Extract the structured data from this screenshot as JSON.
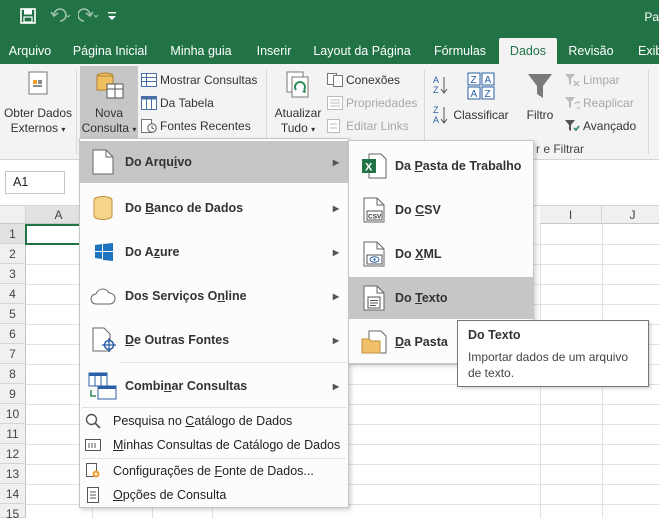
{
  "window": {
    "title": "Pa"
  },
  "tabs": [
    {
      "label": "Arquivo"
    },
    {
      "label": "Página Inicial"
    },
    {
      "label": "Minha guia"
    },
    {
      "label": "Inserir"
    },
    {
      "label": "Layout da Página"
    },
    {
      "label": "Fórmulas"
    },
    {
      "label": "Dados"
    },
    {
      "label": "Revisão"
    },
    {
      "label": "Exib"
    }
  ],
  "ribbon": {
    "external_data": {
      "line1": "Obter Dados",
      "line2": "Externos"
    },
    "new_query": {
      "line1": "Nova",
      "line2": "Consulta"
    },
    "show_queries": "Mostrar Consultas",
    "from_table": "Da Tabela",
    "recent_sources": "Fontes Recentes",
    "refresh_all": {
      "line1": "Atualizar",
      "line2": "Tudo"
    },
    "connections": "Conexões",
    "properties": "Propriedades",
    "edit_links": "Editar Links",
    "sort": "Classificar",
    "filter": "Filtro",
    "clear": "Limpar",
    "reapply": "Reaplicar",
    "advanced": "Avançado",
    "group_sort_filter": "r e Filtrar"
  },
  "namebox": "A1",
  "grid": {
    "columns": [
      "A",
      "I",
      "J"
    ],
    "rows": [
      "1",
      "2",
      "3",
      "4",
      "5",
      "6",
      "7",
      "8",
      "9",
      "10",
      "11",
      "12",
      "13",
      "14",
      "15"
    ]
  },
  "menu_main": {
    "items": [
      {
        "pre": "Do Arqu",
        "u": "i",
        "post": "vo"
      },
      {
        "pre": "Do ",
        "u": "B",
        "post": "anco de Dados"
      },
      {
        "pre": "Do A",
        "u": "z",
        "post": "ure"
      },
      {
        "pre": "Dos Serviços O",
        "u": "n",
        "post": "line"
      },
      {
        "pre": "",
        "u": "D",
        "post": "e Outras Fontes"
      },
      {
        "pre": "Combi",
        "u": "n",
        "post": "ar Consultas"
      }
    ],
    "small_items": [
      {
        "pre": "Pesquisa no ",
        "u": "C",
        "post": "atálogo de Dados"
      },
      {
        "pre": "",
        "u": "M",
        "post": "inhas Consultas de Catálogo de Dados"
      },
      {
        "pre": "Configurações de ",
        "u": "F",
        "post": "onte de Dados..."
      },
      {
        "pre": "",
        "u": "O",
        "post": "pções de Consulta"
      }
    ]
  },
  "menu_sub": {
    "items": [
      {
        "pre": "Da ",
        "u": "P",
        "post": "asta de Trabalho"
      },
      {
        "pre": "Do ",
        "u": "C",
        "post": "SV"
      },
      {
        "pre": "Do ",
        "u": "X",
        "post": "ML"
      },
      {
        "pre": "Do ",
        "u": "T",
        "post": "exto"
      },
      {
        "pre": "",
        "u": "D",
        "post": "a Pasta"
      }
    ],
    "icon_tags": {
      "csv": "CSV"
    }
  },
  "tooltip": {
    "title": "Do Texto",
    "body": "Importar dados de um arquivo de texto."
  },
  "colors": {
    "excel_green": "#217346",
    "ribbon_bg": "#f3f3f3",
    "selected_bg": "#c6c6c6"
  }
}
